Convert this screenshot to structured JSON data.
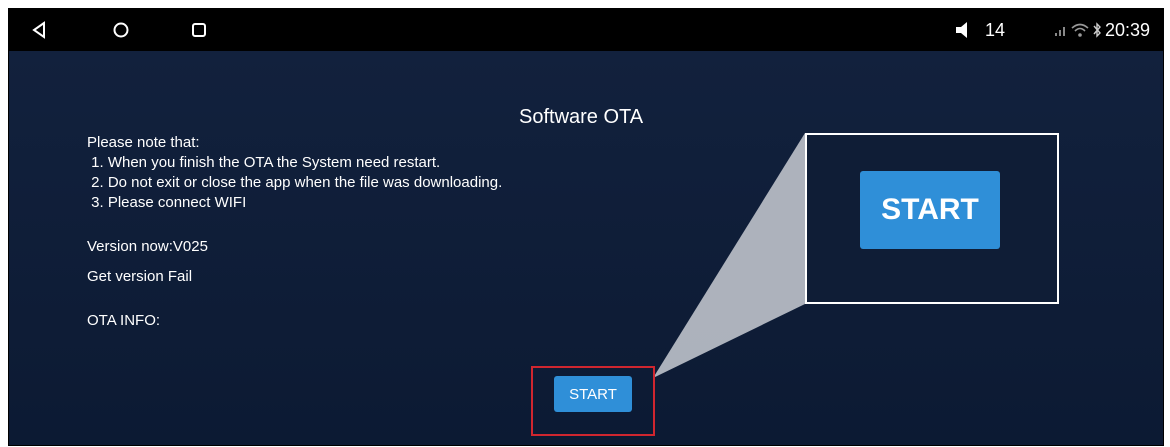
{
  "statusbar": {
    "volume": "14",
    "time": "20:39"
  },
  "app": {
    "title": "Software OTA",
    "notes": [
      "Please note that:",
      " 1. When you finish the OTA the System need restart.",
      " 2. Do not exit or close the app when the file was downloading.",
      " 3. Please connect WIFI"
    ],
    "version_now": "Version now:V025",
    "get_version": "Get version Fail",
    "ota_info": "OTA INFO:",
    "start_label": "START",
    "zoom_start_label": "START"
  },
  "colors": {
    "background": "#0f1d36",
    "button": "#2f8fd8",
    "highlight": "#d0262f"
  }
}
